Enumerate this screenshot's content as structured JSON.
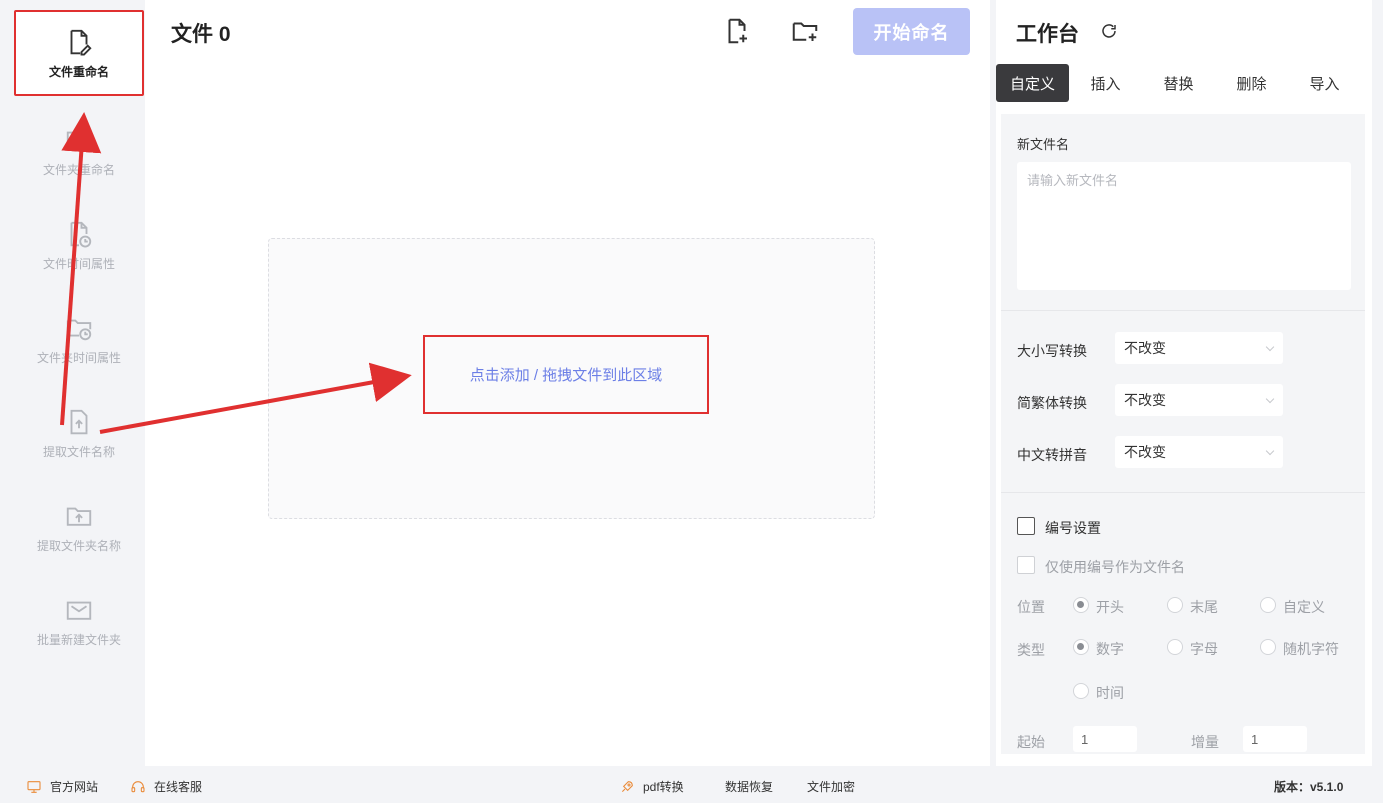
{
  "sidebar": {
    "items": [
      {
        "label": "文件重命名",
        "icon": "file-edit-icon",
        "active": true
      },
      {
        "label": "文件夹重命名",
        "icon": "folder-edit-icon"
      },
      {
        "label": "文件时间属性",
        "icon": "file-clock-icon"
      },
      {
        "label": "文件夹时间属性",
        "icon": "folder-clock-icon"
      },
      {
        "label": "提取文件名称",
        "icon": "file-upload-icon"
      },
      {
        "label": "提取文件夹名称",
        "icon": "folder-upload-icon"
      },
      {
        "label": "批量新建文件夹",
        "icon": "folder-new-icon"
      }
    ]
  },
  "main": {
    "title": "文件 0",
    "start_button": "开始命名",
    "dropzone_text": "点击添加 / 拖拽文件到此区域"
  },
  "panel": {
    "title": "工作台",
    "tabs": [
      "自定义",
      "插入",
      "替换",
      "删除",
      "导入"
    ],
    "active_tab": "自定义",
    "new_name_label": "新文件名",
    "new_name_placeholder": "请输入新文件名",
    "case_label": "大小写转换",
    "case_value": "不改变",
    "trad_label": "简繁体转换",
    "trad_value": "不改变",
    "pinyin_label": "中文转拼音",
    "pinyin_value": "不改变",
    "numbering_label": "编号设置",
    "only_number_label": "仅使用编号作为文件名",
    "position_label": "位置",
    "position_options": [
      "开头",
      "末尾",
      "自定义"
    ],
    "type_label": "类型",
    "type_options": [
      "数字",
      "字母",
      "随机字符",
      "时间"
    ],
    "start_label": "起始",
    "start_value": "1",
    "step_label": "增量",
    "step_value": "1"
  },
  "footer": {
    "website": "官方网站",
    "support": "在线客服",
    "pdf": "pdf转换",
    "recovery": "数据恢复",
    "encrypt": "文件加密",
    "version": "版本：v5.1.0"
  },
  "colors": {
    "accent": "#b9c2f6",
    "link": "#6c7fe6",
    "highlight": "#e03030"
  }
}
